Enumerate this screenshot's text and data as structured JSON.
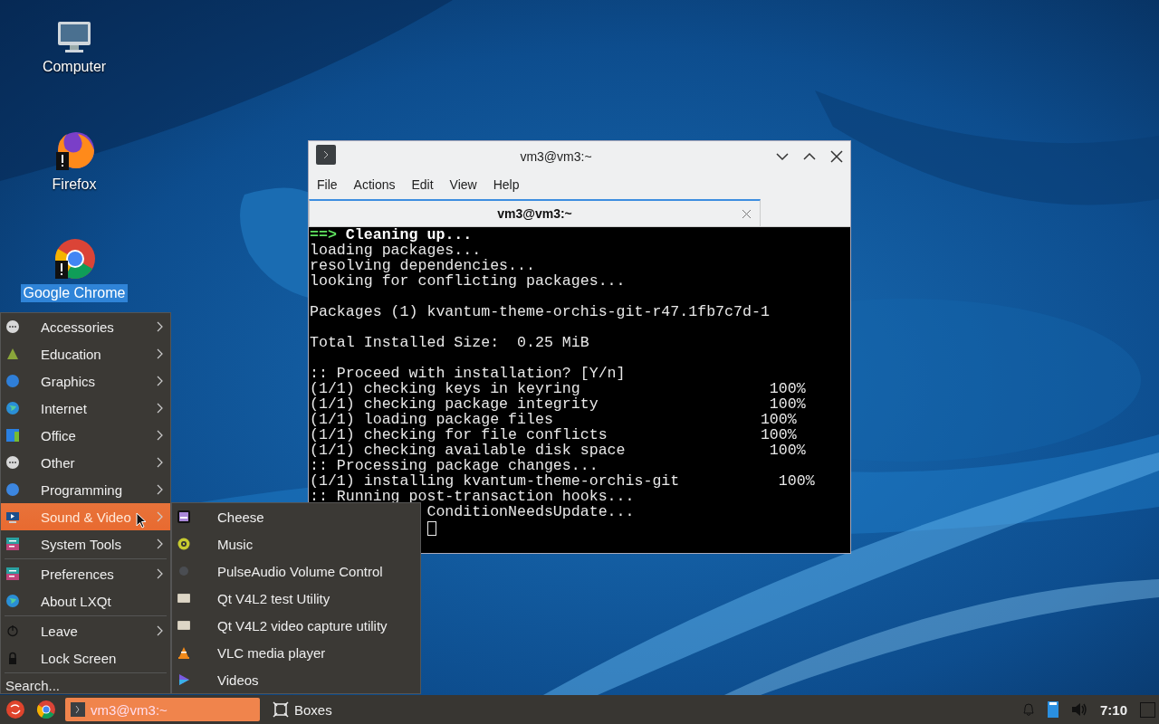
{
  "desktop_icons": [
    {
      "label": "Computer",
      "selected": false
    },
    {
      "label": "Firefox",
      "selected": false
    },
    {
      "label": "Google Chrome",
      "selected": true
    }
  ],
  "terminal_window": {
    "title": "vm3@vm3:~",
    "menu": [
      "File",
      "Actions",
      "Edit",
      "View",
      "Help"
    ],
    "tabs": [
      {
        "label": "vm3@vm3:~",
        "selected": true
      }
    ],
    "lines": [
      {
        "kind": "heading",
        "prompt": "==>",
        "text": "Cleaning up..."
      },
      {
        "kind": "plain",
        "text": "loading packages..."
      },
      {
        "kind": "plain",
        "text": "resolving dependencies..."
      },
      {
        "kind": "plain",
        "text": "looking for conflicting packages..."
      },
      {
        "kind": "blank"
      },
      {
        "kind": "plain",
        "text": "Packages (1) kvantum-theme-orchis-git-r47.1fb7c7d-1"
      },
      {
        "kind": "blank"
      },
      {
        "kind": "plain",
        "text": "Total Installed Size:  0.25 MiB"
      },
      {
        "kind": "blank"
      },
      {
        "kind": "plain",
        "text": ":: Proceed with installation? [Y/n]"
      },
      {
        "kind": "plain",
        "text": "(1/1) checking keys in keyring                     100%"
      },
      {
        "kind": "plain",
        "text": "(1/1) checking package integrity                   100%"
      },
      {
        "kind": "plain",
        "text": "(1/1) loading package files                       100%"
      },
      {
        "kind": "plain",
        "text": "(1/1) checking for file conflicts                 100%"
      },
      {
        "kind": "plain",
        "text": "(1/1) checking available disk space                100%"
      },
      {
        "kind": "plain",
        "text": ":: Processing package changes..."
      },
      {
        "kind": "plain",
        "text": "(1/1) installing kvantum-theme-orchis-git           100%"
      },
      {
        "kind": "plain",
        "text": ":: Running post-transaction hooks..."
      },
      {
        "kind": "plain",
        "text": "             ConditionNeedsUpdate..."
      },
      {
        "kind": "cursor"
      }
    ]
  },
  "app_menu": {
    "groups": [
      [
        {
          "label": "Accessories",
          "submenu": true,
          "selected": false
        },
        {
          "label": "Education",
          "submenu": true,
          "selected": false
        },
        {
          "label": "Graphics",
          "submenu": true,
          "selected": false
        },
        {
          "label": "Internet",
          "submenu": true,
          "selected": false
        },
        {
          "label": "Office",
          "submenu": true,
          "selected": false
        },
        {
          "label": "Other",
          "submenu": true,
          "selected": false
        },
        {
          "label": "Programming",
          "submenu": true,
          "selected": false
        },
        {
          "label": "Sound & Video",
          "submenu": true,
          "selected": true
        },
        {
          "label": "System Tools",
          "submenu": true,
          "selected": false
        }
      ],
      [
        {
          "label": "Preferences",
          "submenu": true,
          "selected": false
        },
        {
          "label": "About LXQt",
          "submenu": false,
          "selected": false
        }
      ],
      [
        {
          "label": "Leave",
          "submenu": true,
          "selected": false
        },
        {
          "label": "Lock Screen",
          "submenu": false,
          "selected": false
        }
      ]
    ],
    "search": {
      "placeholder": "Search..."
    }
  },
  "submenu": {
    "items": [
      {
        "label": "Cheese"
      },
      {
        "label": "Music"
      },
      {
        "label": "PulseAudio Volume Control"
      },
      {
        "label": "Qt V4L2 test Utility"
      },
      {
        "label": "Qt V4L2 video capture utility"
      },
      {
        "label": "VLC media player"
      },
      {
        "label": "Videos"
      }
    ]
  },
  "taskbar": {
    "tasks": [
      {
        "label": "vm3@vm3:~",
        "selected": true
      },
      {
        "label": "Boxes",
        "selected": false
      }
    ],
    "clock": "7:10"
  }
}
